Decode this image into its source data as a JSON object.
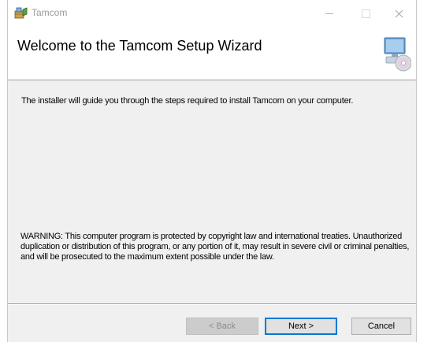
{
  "window": {
    "title": "Tamcom"
  },
  "header": {
    "title": "Welcome to the Tamcom Setup Wizard"
  },
  "content": {
    "intro": "The installer will guide you through the steps required to install Tamcom on your computer.",
    "warning": "WARNING: This computer program is protected by copyright law and international treaties. Unauthorized duplication or distribution of this program, or any portion of it, may result in severe civil or criminal penalties, and will be prosecuted to the maximum extent possible under the law."
  },
  "buttons": {
    "back": "< Back",
    "next": "Next >",
    "cancel": "Cancel"
  },
  "icons": {
    "app": "installer-package-icon",
    "setup": "computer-cd-icon",
    "minimize": "minimize-icon",
    "maximize": "maximize-icon",
    "close": "close-icon"
  },
  "colors": {
    "accent": "#0078d7",
    "dialog_bg": "#f0f0f0",
    "header_bg": "#ffffff"
  }
}
